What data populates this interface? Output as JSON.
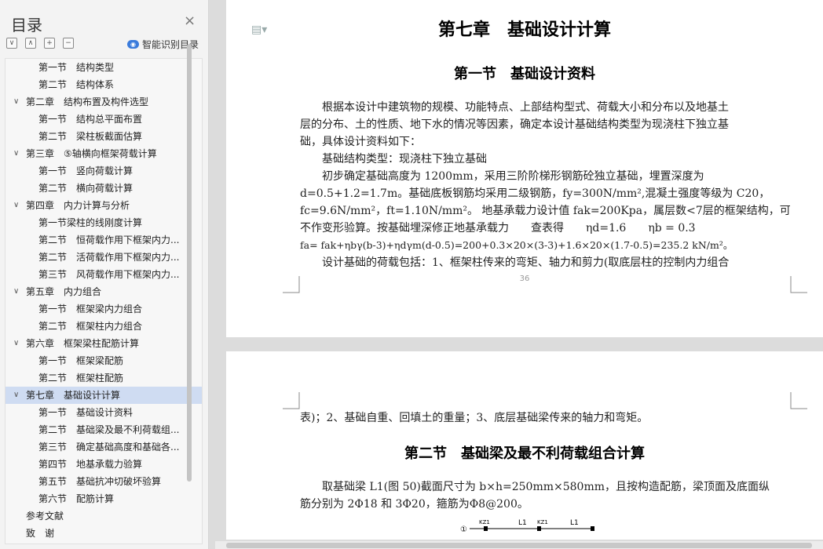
{
  "sidebar": {
    "title": "目录",
    "close": "×",
    "tools": [
      "∨",
      "∧",
      "+",
      "−"
    ],
    "smart_label": "智能识别目录",
    "items": [
      {
        "level": 2,
        "text": "第一节　结构类型"
      },
      {
        "level": 2,
        "text": "第二节　结构体系"
      },
      {
        "level": 1,
        "text": "第二章　结构布置及构件选型",
        "caret": "∨"
      },
      {
        "level": 2,
        "text": "第一节　结构总平面布置"
      },
      {
        "level": 2,
        "text": "第二节　梁柱板截面估算"
      },
      {
        "level": 1,
        "text": "第三章　⑤轴横向框架荷载计算",
        "caret": "∨"
      },
      {
        "level": 2,
        "text": "第一节　竖向荷载计算"
      },
      {
        "level": 2,
        "text": "第二节　横向荷载计算"
      },
      {
        "level": 1,
        "text": "第四章　内力计算与分析",
        "caret": "∨"
      },
      {
        "level": 2,
        "text": "第一节梁柱的线刚度计算"
      },
      {
        "level": 2,
        "text": "第二节　恒荷载作用下框架内力..."
      },
      {
        "level": 2,
        "text": "第二节　活荷载作用下框架内力..."
      },
      {
        "level": 2,
        "text": "第三节　风荷载作用下框架内力..."
      },
      {
        "level": 1,
        "text": "第五章　内力组合",
        "caret": "∨"
      },
      {
        "level": 2,
        "text": "第一节　框架梁内力组合"
      },
      {
        "level": 2,
        "text": "第二节　框架柱内力组合"
      },
      {
        "level": 1,
        "text": "第六章　框架梁柱配筋计算",
        "caret": "∨"
      },
      {
        "level": 2,
        "text": "第一节　框架梁配筋"
      },
      {
        "level": 2,
        "text": "第二节　框架柱配筋"
      },
      {
        "level": 1,
        "text": "第七章　基础设计计算",
        "caret": "∨",
        "selected": true
      },
      {
        "level": 2,
        "text": "第一节　基础设计资料"
      },
      {
        "level": 2,
        "text": "第二节　基础梁及最不利荷载组..."
      },
      {
        "level": 2,
        "text": "第三节　确定基础高度和基础各..."
      },
      {
        "level": 2,
        "text": "第四节　地基承载力验算"
      },
      {
        "level": 2,
        "text": "第五节　基础抗冲切破坏验算"
      },
      {
        "level": 2,
        "text": "第六节　配筋计算"
      },
      {
        "level": 0,
        "text": "参考文献"
      },
      {
        "level": 0,
        "text": "致　谢"
      }
    ]
  },
  "page1": {
    "chapter": "第七章　基础设计计算",
    "section": "第一节　基础设计资料",
    "lines": [
      "　　根据本设计中建筑物的规模、功能特点、上部结构型式、荷载大小和分布以及地基土",
      "层的分布、土的性质、地下水的情况等因素，确定本设计基础结构类型为现浇柱下独立基",
      "础，具体设计资料如下：",
      "　　基础结构类型：现浇柱下独立基础",
      "　　初步确定基础高度为 1200mm，采用三阶阶梯形钢筋砼独立基础，埋置深度为",
      "d=0.5+1.2=1.7m。基础底板钢筋均采用二级钢筋，fy=300N/mm²,混凝土强度等级为 C20，",
      "fc=9.6N/mm²，ft=1.10N/mm²。 地基承载力设计值 fak=200Kpa，属层数<7层的框架结构，可",
      "不作变形验算。按基础埋深修正地基承载力　　查表得　　ηd=1.6　　ηb = 0.3",
      " fa= fak+ηbγ(b-3)+ηdγm(d-0.5)=200+0.3×20×(3-3)+1.6×20×(1.7-0.5)=235.2 kN/m²。",
      "　　设计基础的荷载包括：1、框架柱传来的弯矩、轴力和剪力(取底层柱的控制内力组合"
    ],
    "page_number": "36"
  },
  "page2": {
    "line1": "表)；2、基础自重、回填土的重量；3、底层基础梁传来的轴力和弯矩。",
    "section": "第二节　基础梁及最不利荷载组合计算",
    "lines": [
      "　　取基础梁 L1(图 50)截面尺寸为 b×h=250mm×580mm，且按构造配筋，梁顶面及底面纵",
      "筋分别为 2Φ18 和 3Φ20，箍筋为Φ8@200。"
    ],
    "fig_labels": [
      "①",
      "KZ1",
      "L1",
      "KZ1",
      "L1"
    ]
  },
  "colors": {
    "selected": "#cfdcf2",
    "accent": "#3a7bdb"
  }
}
